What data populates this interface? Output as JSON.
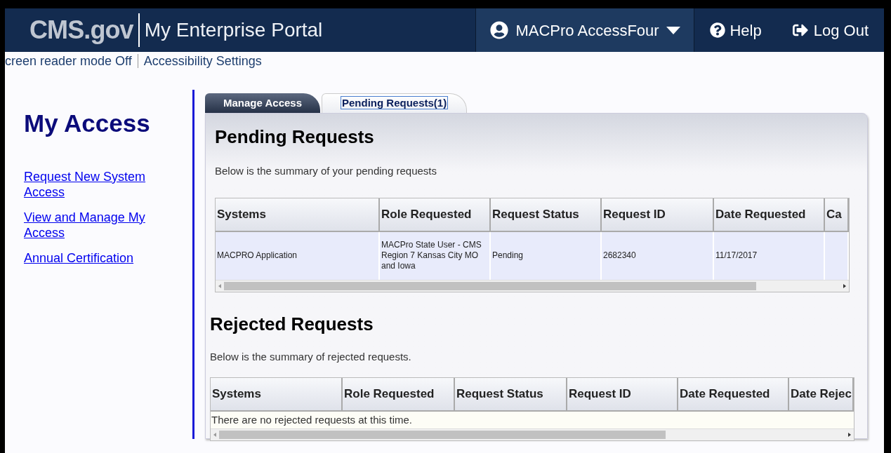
{
  "header": {
    "logo": "CMS.gov",
    "portal_title": "My Enterprise Portal",
    "user_menu": "MACPro AccessFour",
    "help": "Help",
    "logout": "Log Out"
  },
  "utility_bar": {
    "screen_reader": "creen reader mode Off",
    "accessibility": "Accessibility Settings"
  },
  "sidebar": {
    "title": "My Access",
    "links": [
      "Request New System Access",
      "View and Manage My Access",
      "Annual Certification"
    ]
  },
  "tabs": [
    {
      "label": "Manage Access",
      "selected": false
    },
    {
      "label": "Pending Requests(1)",
      "selected": true
    }
  ],
  "pending": {
    "title": "Pending Requests",
    "summary": "Below is the summary of your pending requests",
    "columns": [
      "Systems",
      "Role Requested",
      "Request Status",
      "Request ID",
      "Date Requested",
      "Ca"
    ],
    "rows": [
      [
        "MACPRO Application",
        "MACPro State User - CMS Region 7  Kansas City MO and Iowa",
        "Pending",
        "2682340",
        "11/17/2017",
        ""
      ]
    ]
  },
  "rejected": {
    "title": "Rejected Requests",
    "summary": "Below is the summary of rejected requests.",
    "columns": [
      "Systems",
      "Role Requested",
      "Request Status",
      "Request ID",
      "Date Requested",
      "Date Rejec"
    ],
    "empty_message": "There are no rejected requests at this time."
  }
}
